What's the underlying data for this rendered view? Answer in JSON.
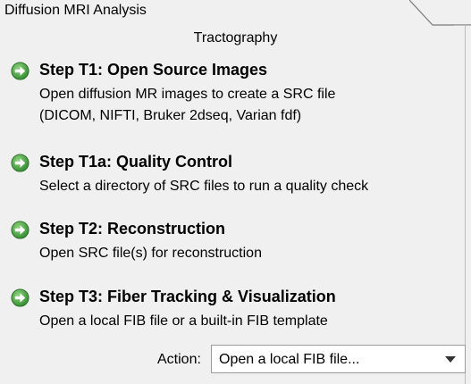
{
  "window": {
    "tab_title": "Diffusion MRI Analysis"
  },
  "group": {
    "title": "Tractography"
  },
  "steps": [
    {
      "icon": "arrow-right-circle-icon",
      "title": "Step T1: Open Source Images",
      "desc_lines": [
        "Open diffusion MR images to create a SRC file",
        "(DICOM, NIFTI, Bruker 2dseq, Varian fdf)"
      ]
    },
    {
      "icon": "arrow-right-circle-icon",
      "title": "Step T1a: Quality Control",
      "desc_lines": [
        "Select a directory of SRC files to run a quality check"
      ]
    },
    {
      "icon": "arrow-right-circle-icon",
      "title": "Step T2: Reconstruction",
      "desc_lines": [
        "Open SRC file(s) for reconstruction"
      ]
    },
    {
      "icon": "arrow-right-circle-icon",
      "title": "Step T3: Fiber Tracking & Visualization",
      "desc_lines": [
        "Open a local FIB file or a built-in FIB template"
      ]
    }
  ],
  "action": {
    "label": "Action:",
    "selected": "Open a local FIB file..."
  },
  "colors": {
    "background": "#f0f0f0",
    "icon_green": "#3f9a3a",
    "icon_green_light": "#7cc66f",
    "select_bg": "#ffffff"
  }
}
